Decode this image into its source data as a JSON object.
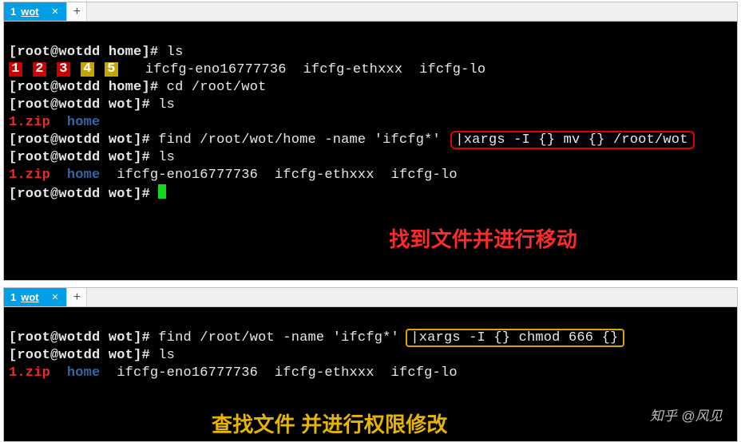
{
  "tab": {
    "index": "1",
    "title": "wot",
    "close": "×",
    "add": "+"
  },
  "host": "wotdd",
  "dirs": {
    "home": "home",
    "wot": "wot"
  },
  "cmd": {
    "ls": "ls",
    "cd": "cd /root/wot",
    "find1_pre": "find /root/wot/home -name 'ifcfg*' ",
    "find1_box": "|xargs -I {} mv {} /root/wot",
    "find2_pre": "find /root/wot -name 'ifcfg*' ",
    "find2_box": "|xargs -I {} chmod 666 {}"
  },
  "num": [
    "1",
    "2",
    "3",
    "4",
    "5"
  ],
  "files": {
    "zip": "1.zip",
    "home": "home",
    "ifcfg1": "ifcfg-eno16777736",
    "ifcfg2": "ifcfg-ethxxx",
    "ifcfg3": "ifcfg-lo"
  },
  "anno1": "找到文件并进行移动",
  "anno2": "查找文件 并进行权限修改",
  "watermark": "知乎 @风见"
}
